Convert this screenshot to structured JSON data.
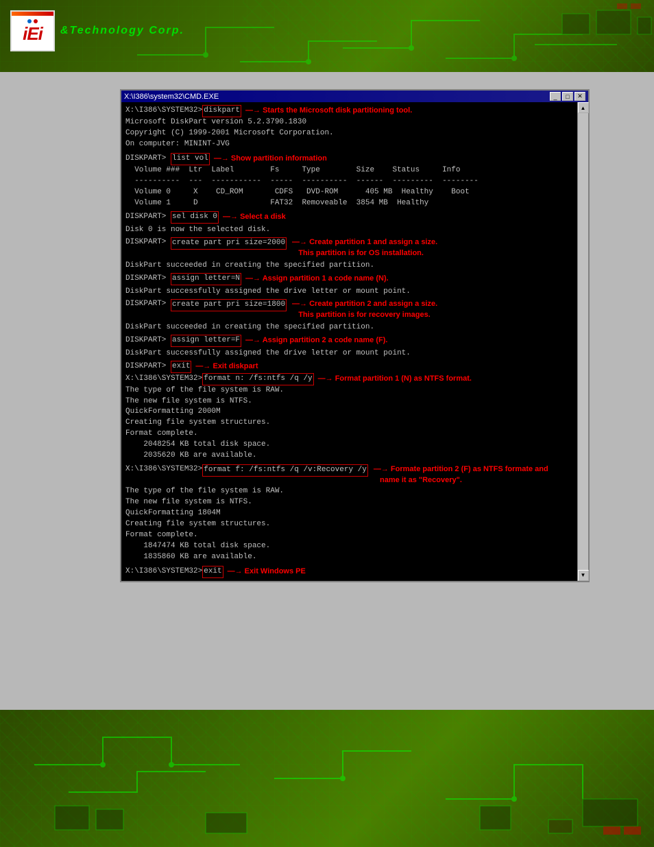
{
  "header": {
    "logo_brand": "iEi",
    "logo_tagline": "Technology Corp.",
    "window_title": "X:\\I386\\system32\\CMD.EXE"
  },
  "cmd": {
    "title": "X:\\I386\\system32\\CMD.EXE",
    "prompt_base": "X:\\I386\\SYSTEM32>",
    "diskpart_prompt": "DISKPART>",
    "lines": [
      {
        "prompt": "X:\\I386\\SYSTEM32>",
        "highlight": "diskpart",
        "annotation": "Starts the Microsoft disk partitioning tool."
      },
      {
        "text": "Microsoft DiskPart version 5.2.3790.1830"
      },
      {
        "text": "Copyright (C) 1999-2001 Microsoft Corporation."
      },
      {
        "text": "On computer: MININT-JVG"
      },
      {
        "text": ""
      },
      {
        "prompt": "DISKPART>",
        "highlight": "list vol",
        "annotation": "Show partition information"
      },
      {
        "table_header": "  Volume ###  Ltr  Label        Fs     Type        Size    Status     Info"
      },
      {
        "table_header": "  ----------  ---  -----------  -----  ----------  ------  ---------  --------"
      },
      {
        "table_row": "  Volume 0     X    CD_ROM       CDFS   DVD-ROM      405 MB  Healthy    Boot"
      },
      {
        "table_row": "  Volume 1     D                 FAT32  Removeable  3854 MB  Healthy"
      },
      {
        "text": ""
      },
      {
        "prompt": "DISKPART>",
        "highlight": "sel disk 0",
        "annotation": "Select a disk"
      },
      {
        "text": ""
      },
      {
        "text": "Disk 0 is now the selected disk."
      },
      {
        "text": ""
      },
      {
        "prompt": "DISKPART>",
        "highlight": "create part pri size=2000",
        "annotation_line1": "Create partition 1 and assign a size.",
        "annotation_line2": "This partition is for OS installation."
      },
      {
        "text": ""
      },
      {
        "text": "DiskPart succeeded in creating the specified partition."
      },
      {
        "text": ""
      },
      {
        "prompt": "DISKPART>",
        "highlight": "assign letter=N",
        "annotation": "Assign partition 1 a code name (N)."
      },
      {
        "text": ""
      },
      {
        "text": "DiskPart successfully assigned the drive letter or mount point."
      },
      {
        "text": ""
      },
      {
        "prompt": "DISKPART>",
        "highlight": "create part pri size=1800",
        "annotation_line1": "Create partition 2 and assign a size.",
        "annotation_line2": "This partition is for recovery images."
      },
      {
        "text": ""
      },
      {
        "text": "DiskPart succeeded in creating the specified partition."
      },
      {
        "text": ""
      },
      {
        "prompt": "DISKPART>",
        "highlight": "assign letter=F",
        "annotation": "Assign partition 2 a code name (F)."
      },
      {
        "text": ""
      },
      {
        "text": "DiskPart successfully assigned the drive letter or mount point."
      },
      {
        "text": ""
      },
      {
        "prompt": "DISKPART>",
        "highlight": "exit",
        "annotation": "Exit diskpart"
      },
      {
        "prompt2": "X:\\I386\\SYSTEM32>",
        "highlight": "format n: /fs:ntfs /q /y",
        "annotation": "Format partition 1 (N) as NTFS format."
      },
      {
        "text": "The type of the file system is RAW."
      },
      {
        "text": "The new file system is NTFS."
      },
      {
        "text": "QuickFormatting 2000M"
      },
      {
        "text": "Creating file system structures."
      },
      {
        "text": "Format complete."
      },
      {
        "text": "    2048254 KB total disk space."
      },
      {
        "text": "    2035620 KB are available."
      },
      {
        "text": ""
      },
      {
        "prompt2": "X:\\I386\\SYSTEM32>",
        "highlight": "format f: /fs:ntfs /q /v:Recovery /y",
        "annotation_line1": "Formate partition 2 (F) as NTFS formate and",
        "annotation_line2": "name it as \"Recovery\"."
      },
      {
        "text": "The type of the file system is RAW."
      },
      {
        "text": "The new file system is NTFS."
      },
      {
        "text": "QuickFormatting 1804M"
      },
      {
        "text": "Creating file system structures."
      },
      {
        "text": "Format complete."
      },
      {
        "text": "    1847474 KB total disk space."
      },
      {
        "text": "    1835860 KB are available."
      },
      {
        "text": ""
      },
      {
        "prompt2": "X:\\I386\\SYSTEM32>",
        "highlight": "exit",
        "annotation": "Exit Windows PE"
      }
    ]
  }
}
